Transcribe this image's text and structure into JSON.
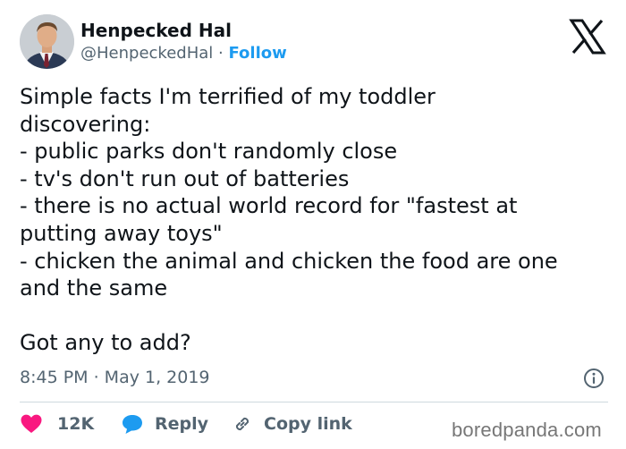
{
  "author": {
    "display_name": "Henpecked Hal",
    "handle": "@HenpeckedHal",
    "separator": "·",
    "follow_label": "Follow",
    "avatar_icon": "profile-photo"
  },
  "platform_icon": "x-logo-icon",
  "tweet": {
    "lines": [
      "Simple facts I'm terrified of my toddler",
      "discovering:",
      "- public parks don't randomly close",
      "- tv's don't run out of batteries",
      "- there is no actual world record for \"fastest at",
      "putting away toys\"",
      "- chicken the animal and chicken the food are one",
      "and the same",
      "",
      "Got any to add?"
    ],
    "timestamp": "8:45 PM · May 1, 2019"
  },
  "actions": {
    "like_count": "12K",
    "reply_label": "Reply",
    "copy_link_label": "Copy link"
  },
  "watermark": "boredpanda.com",
  "colors": {
    "link_blue": "#1d9bf0",
    "like_pink": "#f91880",
    "text": "#0f1419",
    "muted": "#536471"
  }
}
